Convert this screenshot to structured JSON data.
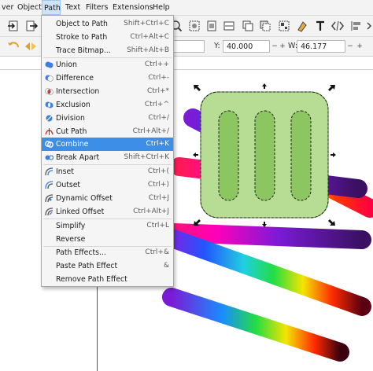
{
  "menubar": {
    "items": [
      {
        "label": "ver"
      },
      {
        "label": "Object"
      },
      {
        "label": "Path"
      },
      {
        "label": "Text"
      },
      {
        "label": "Filters"
      },
      {
        "label": "Extensions"
      },
      {
        "label": "Help"
      }
    ]
  },
  "toolbar": {
    "y_label": "Y:",
    "y_value": "40.000",
    "w_label": "W:",
    "w_value": "46.177"
  },
  "path_menu": {
    "items": [
      {
        "label": "Object to Path",
        "shortcut": "Shift+Ctrl+C",
        "icon": "object-to-path-icon"
      },
      {
        "label": "Stroke to Path",
        "shortcut": "Ctrl+Alt+C",
        "icon": "stroke-to-path-icon"
      },
      {
        "label": "Trace Bitmap...",
        "shortcut": "Shift+Alt+B",
        "icon": "trace-bitmap-icon"
      },
      {
        "label": "Union",
        "shortcut": "Ctrl++",
        "icon": "union-icon"
      },
      {
        "label": "Difference",
        "shortcut": "Ctrl+-",
        "icon": "difference-icon"
      },
      {
        "label": "Intersection",
        "shortcut": "Ctrl+*",
        "icon": "intersection-icon"
      },
      {
        "label": "Exclusion",
        "shortcut": "Ctrl+^",
        "icon": "exclusion-icon"
      },
      {
        "label": "Division",
        "shortcut": "Ctrl+/",
        "icon": "division-icon"
      },
      {
        "label": "Cut Path",
        "shortcut": "Ctrl+Alt+/",
        "icon": "cut-path-icon"
      },
      {
        "label": "Combine",
        "shortcut": "Ctrl+K",
        "icon": "combine-icon"
      },
      {
        "label": "Break Apart",
        "shortcut": "Shift+Ctrl+K",
        "icon": "break-apart-icon"
      },
      {
        "label": "Inset",
        "shortcut": "Ctrl+(",
        "icon": "inset-icon"
      },
      {
        "label": "Outset",
        "shortcut": "Ctrl+)",
        "icon": "outset-icon"
      },
      {
        "label": "Dynamic Offset",
        "shortcut": "Ctrl+J",
        "icon": "dynamic-offset-icon"
      },
      {
        "label": "Linked Offset",
        "shortcut": "Ctrl+Alt+J",
        "icon": "linked-offset-icon"
      },
      {
        "label": "Simplify",
        "shortcut": "Ctrl+L",
        "icon": ""
      },
      {
        "label": "Reverse",
        "shortcut": "",
        "icon": ""
      },
      {
        "label": "Path Effects...",
        "shortcut": "Ctrl+&",
        "icon": ""
      },
      {
        "label": "Paste Path Effect",
        "shortcut": "&",
        "icon": ""
      },
      {
        "label": "Remove Path Effect",
        "shortcut": "",
        "icon": ""
      }
    ],
    "highlighted": "Combine"
  },
  "colors": {
    "accent": "#3d8ee6",
    "shape_fill": "#b7dd94",
    "shape_stroke": "#5d8a3a",
    "bar_fill": "#8cc661"
  }
}
